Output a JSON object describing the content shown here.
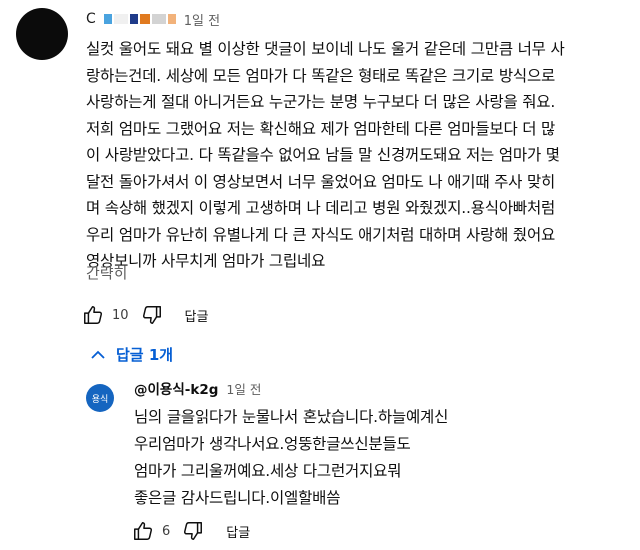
{
  "comment": {
    "author_initial": "C",
    "time": "1일 전",
    "text": "실컷 울어도 돼요 별 이상한 댓글이 보이네 나도 울거 같은데 그만큼 너무 사\n랑하는건데. 세상에 모든 엄마가 다 똑같은 형태로 똑같은 크기로 방식으로\n사랑하는게 절대 아니거든요 누군가는 분명 누구보다 더 많은 사랑을 줘요.\n저희 엄마도 그랬어요 저는 확신해요 제가 엄마한테 다른 엄마들보다 더 많\n이 사랑받았다고. 다 똑같을수 없어요 남들 말 신경꺼도돼요 저는 엄마가 몇\n달전 돌아가셔서 이 영상보면서 너무 울었어요 엄마도 나 애기때 주사 맞히\n며 속상해 했겠지 이렇게 고생하며 나 데리고 병원 와줬겠지..용식아빠처럼\n우리 엄마가 유난히 유별나게 다 큰 자식도 애기처럼 대하며 사랑해 줬어요\n영상보니까 사무치게 엄마가 그립네요",
    "collapse_label": "간략히",
    "like_count": "10",
    "reply_label": "답글",
    "mosaic_colors": [
      "#4aa3df",
      "#f0f0f0",
      "#1f3b8a",
      "#e07a1f",
      "#d3d3d3",
      "#f2b27a"
    ]
  },
  "replies": {
    "toggle_label": "답글 1개"
  },
  "reply": {
    "avatar_text": "용식",
    "author": "@이용식-k2g",
    "time": "1일 전",
    "text": "님의 글을읽다가 눈물나서 혼났습니다.하늘예계신\n우리엄마가 생각나서요.엉뚱한글쓰신분들도\n엄마가 그리울꺼예요.세상 다그런거지요뭐\n좋은글 감사드립니다.이엘할배씀",
    "like_count": "6",
    "reply_label": "답글"
  },
  "icons": {
    "like": "thumbs-up-icon",
    "dislike": "thumbs-down-icon",
    "chevron": "chevron-up-icon"
  },
  "colors": {
    "link_blue": "#065fd4",
    "secondary_text": "#606060",
    "reply_avatar_bg": "#1565c0"
  }
}
